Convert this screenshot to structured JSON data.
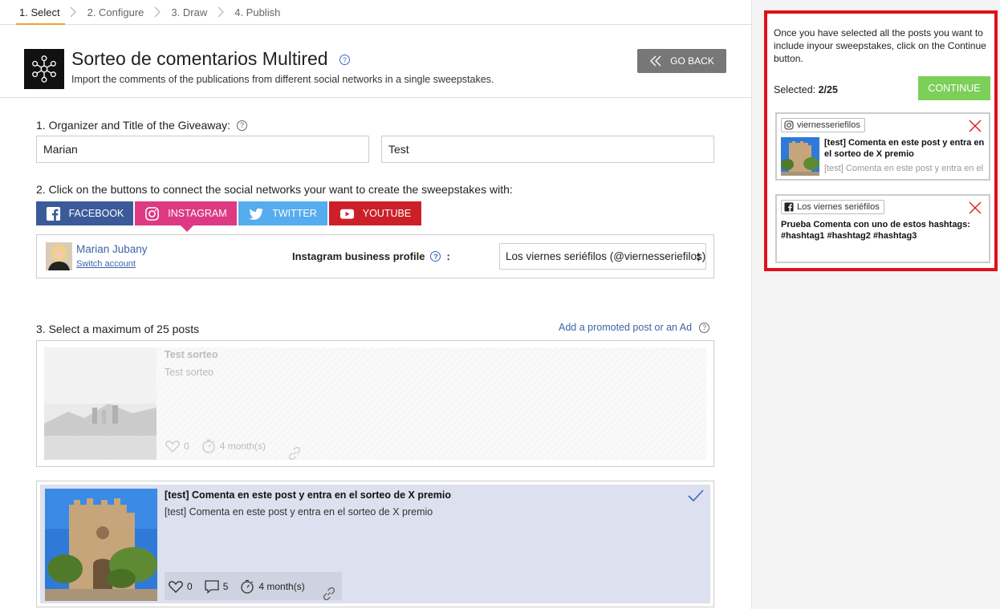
{
  "steps": [
    {
      "label": "1. Select",
      "active": true
    },
    {
      "label": "2. Configure",
      "active": false
    },
    {
      "label": "3. Draw",
      "active": false
    },
    {
      "label": "4. Publish",
      "active": false
    }
  ],
  "header": {
    "title": "Sorteo de comentarios Multired",
    "subtitle": "Import the comments of the publications from different social networks in a single sweepstakes.",
    "go_back_label": "GO BACK",
    "help_glyph": "?"
  },
  "section1": {
    "label": "1.  Organizer and Title of the Giveaway:",
    "organizer_value": "Marian",
    "title_value": "Test"
  },
  "section2": {
    "label": "2. Click on the buttons to connect the social networks your want to create the sweepstakes with:",
    "networks": {
      "facebook": "FACEBOOK",
      "instagram": "INSTAGRAM",
      "twitter": "TWITTER",
      "youtube": "YOUTUBE"
    },
    "profile": {
      "name": "Marian Jubany",
      "switch_label": "Switch account",
      "business_label": "Instagram business profile",
      "business_suffix": ":",
      "selected_profile": "Los viernes seriéfilos (@viernesseriefilos)"
    }
  },
  "section3": {
    "label": "3. Select a maximum of 25 posts",
    "promo_link": "Add a promoted post or an Ad",
    "posts": [
      {
        "title": "Test sorteo",
        "text": "Test sorteo",
        "likes": "0",
        "age": "4 month(s)"
      },
      {
        "title": "[test] Comenta en este post y entra en el sorteo de X premio",
        "text": "[test] Comenta en este post y entra en el sorteo de X premio",
        "likes": "0",
        "comments": "5",
        "age": "4 month(s)"
      }
    ]
  },
  "right_panel": {
    "instructions": "Once you have selected all the posts you want to include inyour sweepstakes, click on the Continue button.",
    "selected_label": "Selected:",
    "selected_count": "2/25",
    "continue_label": "CONTINUE",
    "selected_posts": [
      {
        "account": "viernesseriefilos",
        "network": "instagram",
        "title": "[test] Comenta en este post y entra en el sorteo de X premio",
        "text": "[test] Comenta en este post y entra en el sorteo de X premio"
      },
      {
        "account": "Los viernes seriéfilos",
        "network": "facebook",
        "title": "Prueba Comenta con uno de estos hashtags: #hashtag1 #hashtag2 #hashtag3"
      }
    ]
  },
  "colors": {
    "facebook": "#3b5a9a",
    "instagram": "#dd3a83",
    "twitter": "#55acee",
    "youtube": "#cc2029",
    "continue": "#7ccf58",
    "highlight_border": "#e0101a",
    "active_step": "#f0a030"
  },
  "icons": [
    "chevron-right-icon",
    "network-hub-icon",
    "double-chevron-left-icon",
    "help-icon",
    "facebook-icon",
    "instagram-icon",
    "twitter-icon",
    "youtube-icon",
    "heart-icon",
    "comment-icon",
    "timer-icon",
    "link-icon",
    "checkmark-icon",
    "close-icon"
  ]
}
